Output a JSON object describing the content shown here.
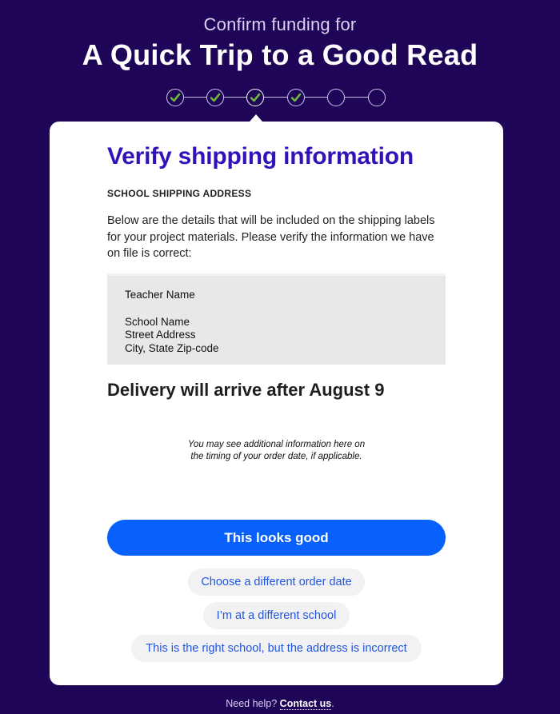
{
  "header": {
    "subtitle": "Confirm funding for",
    "project_title": "A Quick Trip to a Good Read"
  },
  "stepper": {
    "steps": [
      {
        "state": "complete",
        "icon": "check-icon"
      },
      {
        "state": "complete",
        "icon": "check-icon"
      },
      {
        "state": "current",
        "icon": "check-icon"
      },
      {
        "state": "complete",
        "icon": "check-icon"
      },
      {
        "state": "pending",
        "icon": ""
      },
      {
        "state": "pending",
        "icon": ""
      }
    ],
    "check_color": "#6db33f"
  },
  "card": {
    "heading": "Verify shipping information",
    "section_label": "SCHOOL SHIPPING ADDRESS",
    "description": "Below are the details that will be included on the shipping labels for your project materials. Please verify the information we have on file is correct:",
    "address": {
      "teacher_name": "Teacher Name",
      "school_name": "School Name",
      "street": "Street Address",
      "city_line": "City, State Zip-code"
    },
    "delivery": "Delivery will arrive after August 9",
    "note_line1": "You may see additional information here on",
    "note_line2": "the timing of your order date, if applicable.",
    "primary_button": "This looks good",
    "secondary_buttons": [
      "Choose a different order date",
      "I’m at a different school",
      "This is the right school, but the address is incorrect"
    ]
  },
  "footer": {
    "prefix": "Need help?",
    "link": "Contact us",
    "suffix": "."
  },
  "colors": {
    "background": "#1e0557",
    "heading": "#3211b8",
    "primary": "#0861fc",
    "link": "#1f56e0"
  }
}
